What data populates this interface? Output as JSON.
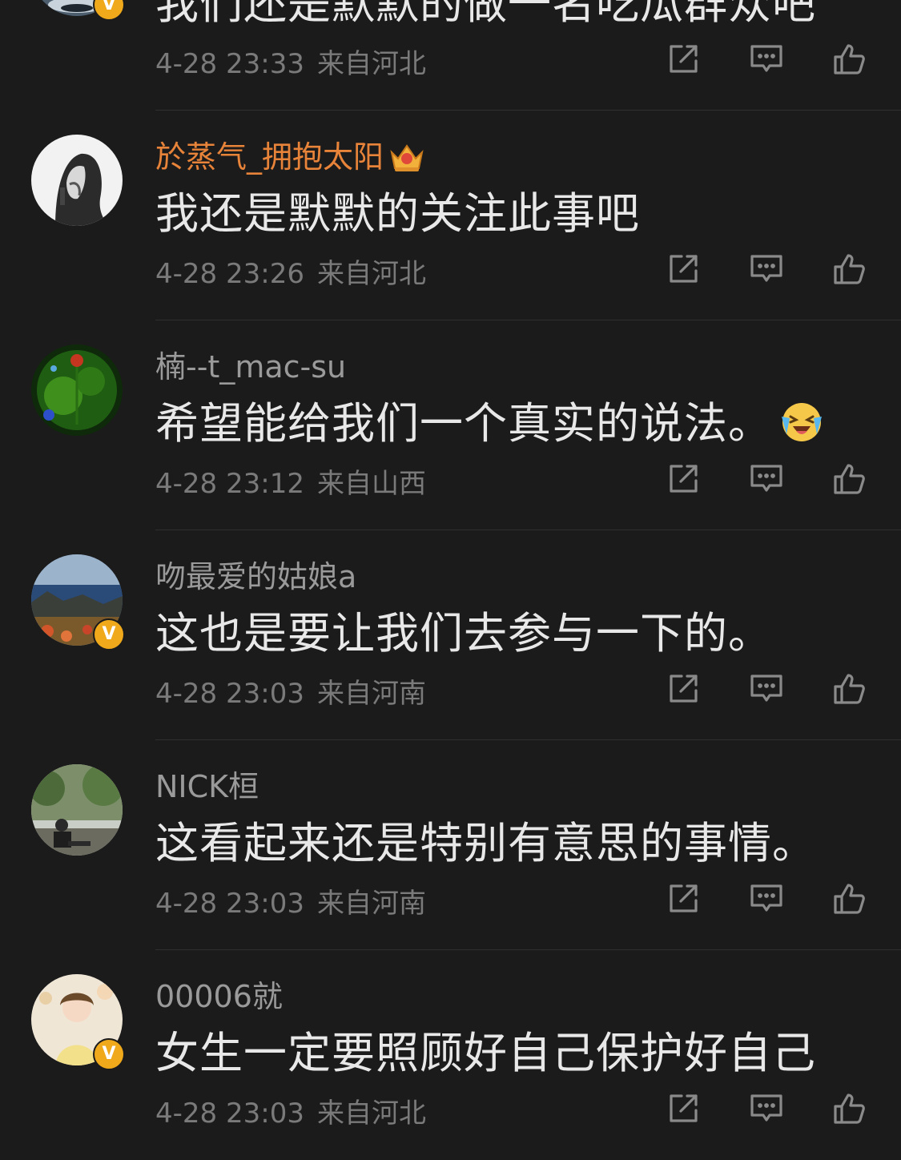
{
  "comments": [
    {
      "username": "",
      "text": "我们还是默默的做一名吃瓜群众吧",
      "time": "4-28 23:33",
      "location": "来自河北",
      "verified": true,
      "vip_crown": false
    },
    {
      "username": "於蒸气_拥抱太阳",
      "text": "我还是默默的关注此事吧",
      "time": "4-28 23:26",
      "location": "来自河北",
      "verified": false,
      "vip_crown": true
    },
    {
      "username": "楠--t_mac-su",
      "text": "希望能给我们一个真实的说法。",
      "time": "4-28 23:12",
      "location": "来自山西",
      "verified": false,
      "vip_crown": false,
      "emoji": "laughing-crying-emoji"
    },
    {
      "username": "吻最爱的姑娘a",
      "text": "这也是要让我们去参与一下的。",
      "time": "4-28 23:03",
      "location": "来自河南",
      "verified": true,
      "vip_crown": false
    },
    {
      "username": "NICK桓",
      "text": "这看起来还是特别有意思的事情。",
      "time": "4-28 23:03",
      "location": "来自河南",
      "verified": false,
      "vip_crown": false
    },
    {
      "username": "00006就",
      "text": "女生一定要照顾好自己保护好自己",
      "time": "4-28 23:03",
      "location": "来自河北",
      "verified": true,
      "vip_crown": false
    }
  ],
  "badge_label": "V",
  "colors": {
    "background": "#1b1b1b",
    "username_default": "#9a9a9a",
    "username_vip": "#e8833a",
    "badge": "#f0a91b",
    "meta": "#7a7a7a"
  },
  "icons": {
    "share": "share-icon",
    "comment": "comment-icon",
    "like": "like-icon"
  }
}
